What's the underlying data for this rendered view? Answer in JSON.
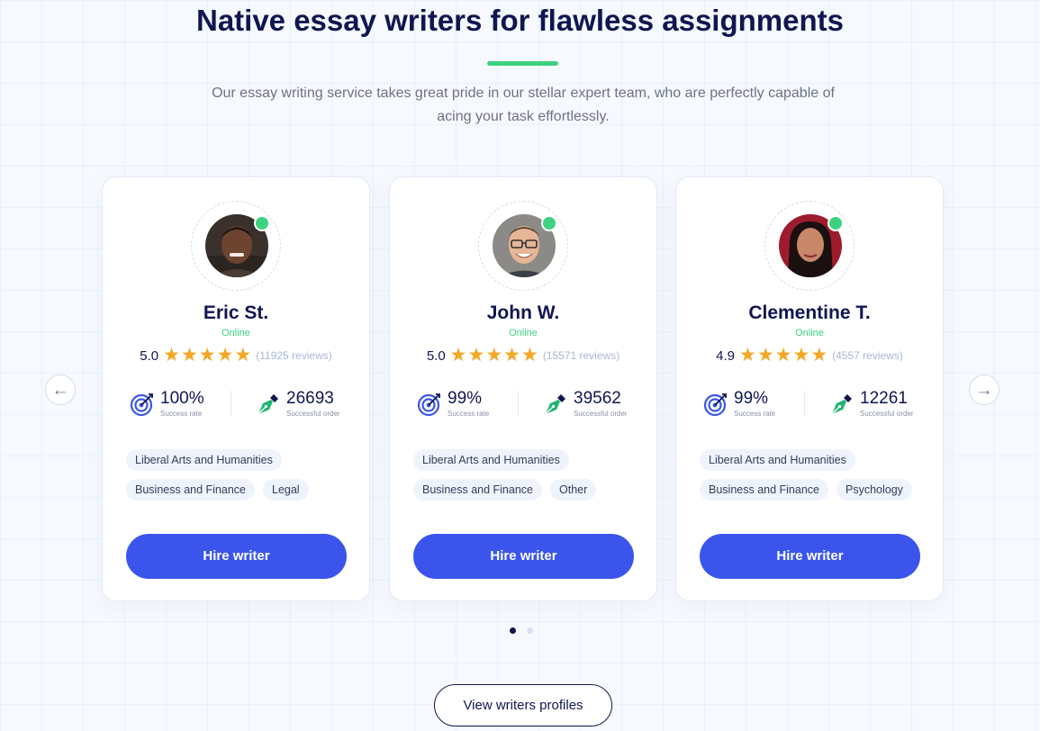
{
  "header": {
    "title": "Native essay writers for flawless assignments",
    "subtitle": "Our essay writing service takes great pride in our stellar expert team, who are perfectly capable of acing your task effortlessly."
  },
  "carousel": {
    "prev_icon": "arrow-left-icon",
    "next_icon": "arrow-right-icon",
    "pagination": {
      "active_index": 0,
      "count": 2
    }
  },
  "writers": [
    {
      "name": "Eric St.",
      "status": "Online",
      "rating": "5.0",
      "stars": 5,
      "reviews": "(11925 reviews)",
      "success_rate": "100%",
      "success_rate_label": "Success rate",
      "orders": "26693",
      "orders_label": "Successful order",
      "tags": [
        "Liberal Arts and Humanities",
        "Business and Finance",
        "Legal"
      ],
      "hire_label": "Hire writer"
    },
    {
      "name": "John W.",
      "status": "Online",
      "rating": "5.0",
      "stars": 5,
      "reviews": "(15571 reviews)",
      "success_rate": "99%",
      "success_rate_label": "Success rate",
      "orders": "39562",
      "orders_label": "Successful order",
      "tags": [
        "Liberal Arts and Humanities",
        "Business and Finance",
        "Other"
      ],
      "hire_label": "Hire writer"
    },
    {
      "name": "Clementine T.",
      "status": "Online",
      "rating": "4.9",
      "stars": 5,
      "reviews": "(4557 reviews)",
      "success_rate": "99%",
      "success_rate_label": "Success rate",
      "orders": "12261",
      "orders_label": "Successful order",
      "tags": [
        "Liberal Arts and Humanities",
        "Business and Finance",
        "Psychology"
      ],
      "hire_label": "Hire writer"
    }
  ],
  "view_profiles_label": "View writers profiles",
  "colors": {
    "primary": "#3b55ec",
    "heading": "#101650",
    "online": "#3dd27f",
    "star": "#f5a623",
    "reviews": "#a9b8d4",
    "stat_icon_blue": "#3b55ec",
    "stat_icon_green": "#22b573"
  }
}
